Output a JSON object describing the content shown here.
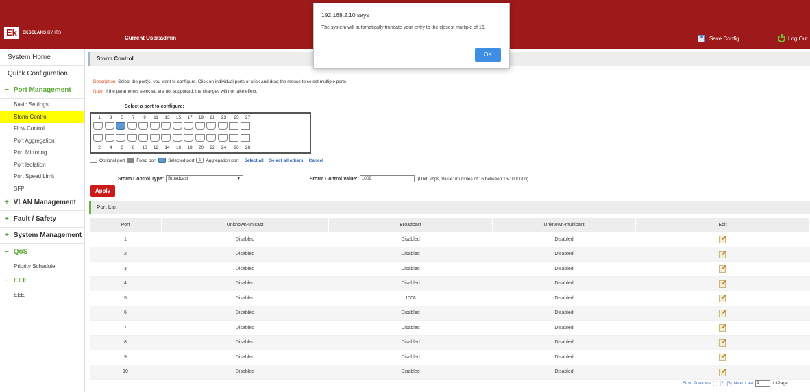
{
  "header": {
    "logo_mark": "Ek",
    "logo_brand": "EKSELANS",
    "logo_by": "BY ITS",
    "current_user": "Current User:admin",
    "save_config": "Save Config",
    "log_out": "Log Out"
  },
  "sidebar": {
    "top_items": [
      "System Home",
      "Quick Configuration"
    ],
    "port_management": {
      "sign": "−",
      "label": "Port Management",
      "items": [
        "Basic Settings",
        "Storm Control",
        "Flow Control",
        "Port Aggregation",
        "Port Mirroring",
        "Port Isolation",
        "Port Speed Limit",
        "SFP"
      ]
    },
    "vlan": {
      "sign": "+",
      "label": "VLAN Management"
    },
    "fault": {
      "sign": "+",
      "label": "Fault / Safety"
    },
    "system": {
      "sign": "+",
      "label": "System Management"
    },
    "qos": {
      "sign": "−",
      "label": "QoS",
      "items": [
        "Priority Schedule"
      ]
    },
    "eee": {
      "sign": "−",
      "label": "EEE",
      "items": [
        "EEE"
      ]
    }
  },
  "panel": {
    "title": "Storm Control",
    "desc_label": "Description:",
    "desc_text": " Select the port(s) you want to configure. Click on individual ports or click and drag the mouse to select multiple ports.",
    "note_label": "Note:",
    "note_text": " If the parameters selected are not supported, the changes will not take effect.",
    "select_title": "Select a port to configure:"
  },
  "ports": {
    "top_numbers": [
      "1",
      "3",
      "5",
      "7",
      "9",
      "11",
      "13",
      "15",
      "17",
      "19",
      "21",
      "23",
      "25",
      "27"
    ],
    "bottom_numbers": [
      "2",
      "4",
      "6",
      "8",
      "10",
      "12",
      "14",
      "16",
      "18",
      "20",
      "22",
      "24",
      "26",
      "28"
    ],
    "selected_port": 5
  },
  "legend": {
    "optional": "Optional port",
    "fixed": "Fixed port",
    "selected": "Selected port",
    "agg_mark": "1",
    "aggregation": "Aggregation port",
    "select_all": "Select all",
    "select_all_others": "Select all others",
    "cancel": "Cancel"
  },
  "form": {
    "type_label": "Storm Control Type:",
    "type_value": "Broadcast",
    "value_label": "Storm Control Value:",
    "value": "1009",
    "unit_hint": "(Unit: kbps, Value: multiples of 16 between 16-1000000)",
    "apply": "Apply"
  },
  "port_list": {
    "title": "Port List",
    "columns": [
      "Port",
      "Unknown-unicast",
      "Broadcast",
      "Unknown-multicast",
      "Edit"
    ],
    "rows": [
      [
        "1",
        "Disabled",
        "Disabled",
        "Disabled"
      ],
      [
        "2",
        "Disabled",
        "Disabled",
        "Disabled"
      ],
      [
        "3",
        "Disabled",
        "Disabled",
        "Disabled"
      ],
      [
        "4",
        "Disabled",
        "Disabled",
        "Disabled"
      ],
      [
        "5",
        "Disabled",
        "1008",
        "Disabled"
      ],
      [
        "6",
        "Disabled",
        "Disabled",
        "Disabled"
      ],
      [
        "7",
        "Disabled",
        "Disabled",
        "Disabled"
      ],
      [
        "8",
        "Disabled",
        "Disabled",
        "Disabled"
      ],
      [
        "9",
        "Disabled",
        "Disabled",
        "Disabled"
      ],
      [
        "10",
        "Disabled",
        "Disabled",
        "Disabled"
      ]
    ]
  },
  "pagination": {
    "first": "First",
    "previous": "Previous",
    "pages": [
      "[1]",
      "[2]",
      "[3]"
    ],
    "next": "Next",
    "last": "Last",
    "input_value": "1",
    "total": "/ 3Page"
  },
  "dialog": {
    "title": "192.168.2.10 says",
    "message": "The system will automatically truncate your entry to the closest multiple of 16.",
    "ok": "OK"
  },
  "colors": {
    "header_bg": "#9e1a1a",
    "accent_green": "#5aa833",
    "active_yellow": "#ffff00",
    "apply_red": "#cc1a1a",
    "ok_blue": "#3e8ee3"
  }
}
